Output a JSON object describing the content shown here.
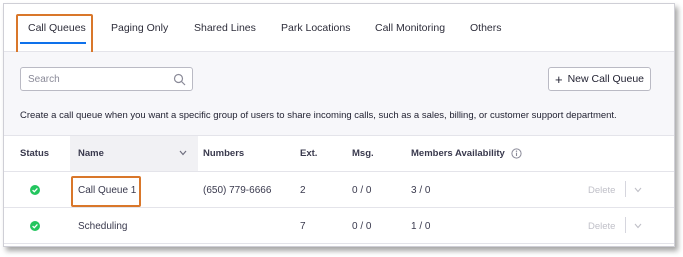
{
  "tabs": [
    {
      "label": "Call Queues",
      "active": true
    },
    {
      "label": "Paging Only",
      "active": false
    },
    {
      "label": "Shared Lines",
      "active": false
    },
    {
      "label": "Park Locations",
      "active": false
    },
    {
      "label": "Call Monitoring",
      "active": false
    },
    {
      "label": "Others",
      "active": false
    }
  ],
  "toolbar": {
    "search_placeholder": "Search",
    "new_button_label": "New Call Queue",
    "description": "Create a call queue when you want a specific group of users to share incoming calls, such as a sales, billing, or customer support department."
  },
  "table": {
    "headers": {
      "status": "Status",
      "name": "Name",
      "numbers": "Numbers",
      "ext": "Ext.",
      "msg": "Msg.",
      "members": "Members Availability"
    },
    "rows": [
      {
        "status": "active",
        "name": "Call Queue 1",
        "numbers": "(650) 779-6666",
        "ext": "2",
        "msg": "0 / 0",
        "members": "3 / 0",
        "action": "Delete"
      },
      {
        "status": "active",
        "name": "Scheduling",
        "numbers": "",
        "ext": "7",
        "msg": "0 / 0",
        "members": "1 / 0",
        "action": "Delete"
      }
    ]
  },
  "icons": {
    "search": "search-icon",
    "plus": "plus-icon",
    "sort": "chevron-down-icon",
    "info": "info-icon",
    "status": "check-circle-icon",
    "row_menu": "chevron-down-icon"
  },
  "colors": {
    "accent": "#0e71eb",
    "highlight": "#d9772a",
    "status_green": "#23c55e"
  }
}
